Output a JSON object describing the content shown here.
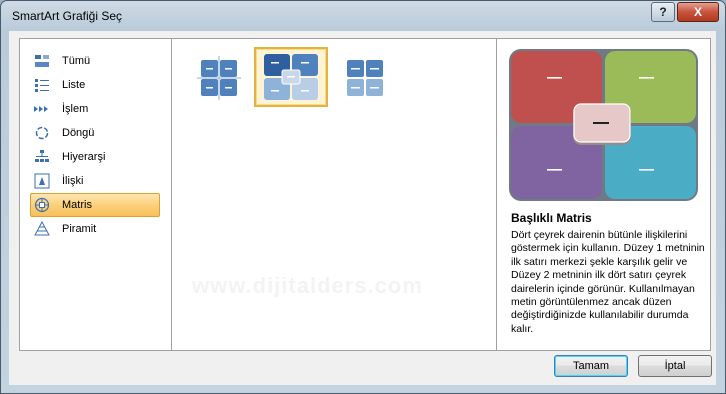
{
  "window": {
    "title": "SmartArt Grafiği Seç",
    "help_label": "?",
    "close_label": "X"
  },
  "categories": [
    {
      "label": "Tümü",
      "icon": "all-icon",
      "selected": false
    },
    {
      "label": "Liste",
      "icon": "list-icon",
      "selected": false
    },
    {
      "label": "İşlem",
      "icon": "process-icon",
      "selected": false
    },
    {
      "label": "Döngü",
      "icon": "cycle-icon",
      "selected": false
    },
    {
      "label": "Hiyerarşi",
      "icon": "hierarchy-icon",
      "selected": false
    },
    {
      "label": "İlişki",
      "icon": "relationship-icon",
      "selected": false
    },
    {
      "label": "Matris",
      "icon": "matrix-icon",
      "selected": true
    },
    {
      "label": "Piramit",
      "icon": "pyramid-icon",
      "selected": false
    }
  ],
  "gallery": [
    {
      "name": "matrix-layout-1",
      "selected": false
    },
    {
      "name": "matrix-layout-2",
      "selected": true
    },
    {
      "name": "matrix-layout-3",
      "selected": false
    }
  ],
  "preview": {
    "title": "Başlıklı Matris",
    "description": "Dört çeyrek dairenin bütünle ilişkilerini göstermek için kullanın. Düzey 1 metninin ilk satırı merkezi şekle karşılık gelir ve Düzey 2 metninin ilk dört satırı çeyrek dairelerin içinde görünür. Kullanılmayan metin görüntülenmez ancak düzen değiştirdiğinizde kullanılabilir durumda kalır.",
    "quadrant_colors": [
      "#c0504d",
      "#9bbb59",
      "#8064a2",
      "#4bacc6"
    ],
    "center_color": "#e6c8c8"
  },
  "buttons": {
    "ok_label": "Tamam",
    "cancel_label": "İptal"
  },
  "watermark": "www.dijitalders.com"
}
